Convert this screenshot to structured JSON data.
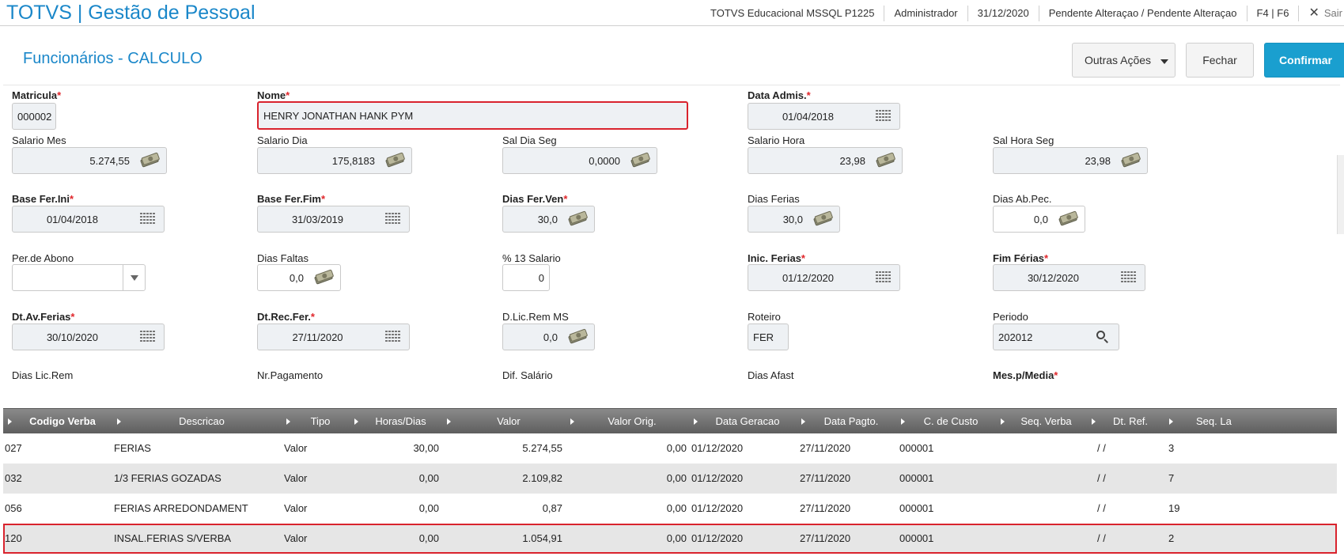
{
  "app": {
    "title": "TOTVS | Gestão de Pessoal"
  },
  "status": {
    "environment": "TOTVS Educacional MSSQL P1225",
    "user": "Administrador",
    "date": "31/12/2020",
    "state": "Pendente Alteraçao / Pendente Alteraçao",
    "keys": "F4 | F6",
    "exit": "Sair"
  },
  "page": {
    "title": "Funcionários - CALCULO"
  },
  "actions": {
    "outras": "Outras Ações",
    "fechar": "Fechar",
    "confirmar": "Confirmar"
  },
  "form": {
    "matricula": {
      "label": "Matricula",
      "value": "000002"
    },
    "nome": {
      "label": "Nome",
      "value": "HENRY JONATHAN HANK PYM"
    },
    "data_admis": {
      "label": "Data Admis.",
      "value": "01/04/2018"
    },
    "salario_mes": {
      "label": "Salario Mes",
      "value": "5.274,55"
    },
    "salario_dia": {
      "label": "Salario Dia",
      "value": "175,8183"
    },
    "sal_dia_seg": {
      "label": "Sal Dia Seg",
      "value": "0,0000"
    },
    "salario_hora": {
      "label": "Salario Hora",
      "value": "23,98"
    },
    "sal_hora_seg": {
      "label": "Sal Hora Seg",
      "value": "23,98"
    },
    "base_fer_ini": {
      "label": "Base Fer.Ini",
      "value": "01/04/2018"
    },
    "base_fer_fim": {
      "label": "Base Fer.Fim",
      "value": "31/03/2019"
    },
    "dias_fer_ven": {
      "label": "Dias Fer.Ven",
      "value": "30,0"
    },
    "dias_ferias": {
      "label": "Dias Ferias",
      "value": "30,0"
    },
    "dias_ab_pec": {
      "label": "Dias Ab.Pec.",
      "value": "0,0"
    },
    "per_abono": {
      "label": "Per.de Abono",
      "value": ""
    },
    "dias_faltas": {
      "label": "Dias Faltas",
      "value": "0,0"
    },
    "pct_13": {
      "label": "% 13 Salario",
      "value": "0"
    },
    "inic_ferias": {
      "label": "Inic. Ferias",
      "value": "01/12/2020"
    },
    "fim_ferias": {
      "label": "Fim Férias",
      "value": "30/12/2020"
    },
    "dt_av_ferias": {
      "label": "Dt.Av.Ferias",
      "value": "30/10/2020"
    },
    "dt_rec_fer": {
      "label": "Dt.Rec.Fer.",
      "value": "27/11/2020"
    },
    "d_lic_rem": {
      "label": "D.Lic.Rem MS",
      "value": "0,0"
    },
    "roteiro": {
      "label": "Roteiro",
      "value": "FER"
    },
    "periodo": {
      "label": "Periodo",
      "value": "202012"
    },
    "partial_labels": [
      "Dias Lic.Rem",
      "Nr.Pagamento",
      "Dif. Salário",
      "Dias Afast",
      "Mes.p/Media"
    ]
  },
  "grid": {
    "headers": [
      "Codigo Verba",
      "Descricao",
      "Tipo",
      "Horas/Dias",
      "Valor",
      "Valor Orig.",
      "Data Geracao",
      "Data Pagto.",
      "C. de Custo",
      "Seq. Verba",
      "Dt. Ref.",
      "Seq. La"
    ],
    "rows": [
      {
        "codigo": "027",
        "descricao": "FERIAS",
        "tipo": "Valor",
        "horas": "30,00",
        "valor": "5.274,55",
        "valor_orig": "0,00",
        "data_geracao": "01/12/2020",
        "data_pagto": "27/11/2020",
        "custo": "000001",
        "seq_verba": "",
        "dt_ref": "/ /",
        "seq_la": "3"
      },
      {
        "codigo": "032",
        "descricao": "1/3 FERIAS GOZADAS",
        "tipo": "Valor",
        "horas": "0,00",
        "valor": "2.109,82",
        "valor_orig": "0,00",
        "data_geracao": "01/12/2020",
        "data_pagto": "27/11/2020",
        "custo": "000001",
        "seq_verba": "",
        "dt_ref": "/ /",
        "seq_la": "7"
      },
      {
        "codigo": "056",
        "descricao": "FERIAS ARREDONDAMENT",
        "tipo": "Valor",
        "horas": "0,00",
        "valor": "0,87",
        "valor_orig": "0,00",
        "data_geracao": "01/12/2020",
        "data_pagto": "27/11/2020",
        "custo": "000001",
        "seq_verba": "",
        "dt_ref": "/ /",
        "seq_la": "19"
      },
      {
        "codigo": "120",
        "descricao": "INSAL.FERIAS S/VERBA",
        "tipo": "Valor",
        "horas": "0,00",
        "valor": "1.054,91",
        "valor_orig": "0,00",
        "data_geracao": "01/12/2020",
        "data_pagto": "27/11/2020",
        "custo": "000001",
        "seq_verba": "",
        "dt_ref": "/ /",
        "seq_la": "2"
      }
    ]
  },
  "colors": {
    "brand": "#1a87c9",
    "confirm": "#1a9fcf",
    "highlight": "#d9232d",
    "required": "#e0262b"
  }
}
